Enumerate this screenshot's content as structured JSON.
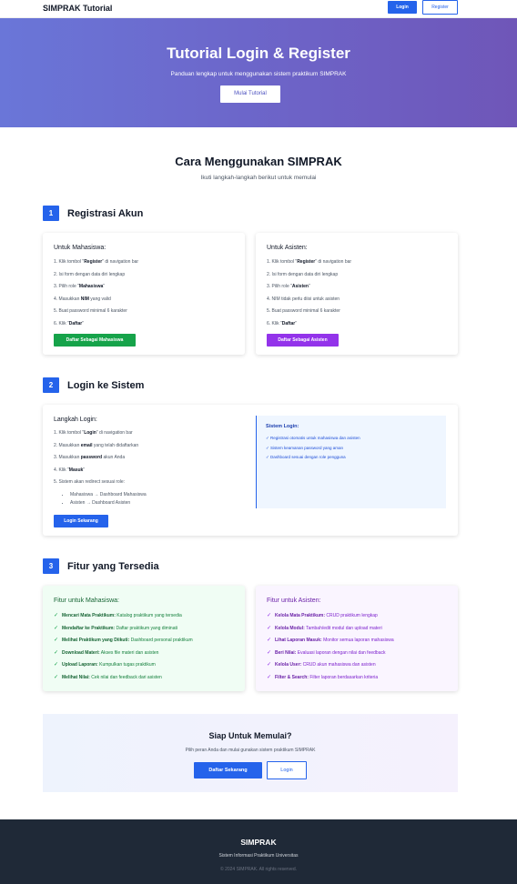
{
  "nav": {
    "brand": "SIMPRAK Tutorial",
    "login": "Login",
    "register": "Register"
  },
  "hero": {
    "title": "Tutorial Login & Register",
    "subtitle": "Panduan lengkap untuk menggunakan sistem praktikum SIMPRAK",
    "button": "Mulai Tutorial"
  },
  "intro": {
    "title": "Cara Menggunakan SIMPRAK",
    "subtitle": "Ikuti langkah-langkah berikut untuk memulai"
  },
  "step1": {
    "num": "1",
    "title": "Registrasi Akun",
    "mahasiswa": {
      "heading": "Untuk Mahasiswa:",
      "items": [
        {
          "pre": "1. Klik tombol \"",
          "b": "Register",
          "post": "\" di navigation bar"
        },
        {
          "pre": "2. Isi form dengan data diri lengkap",
          "b": "",
          "post": ""
        },
        {
          "pre": "3. Pilih role \"",
          "b": "Mahasiswa",
          "post": "\""
        },
        {
          "pre": "4. Masukkan ",
          "b": "NIM",
          "post": " yang valid"
        },
        {
          "pre": "5. Buat password minimal 6 karakter",
          "b": "",
          "post": ""
        },
        {
          "pre": "6. Klik \"",
          "b": "Daftar",
          "post": "\""
        }
      ],
      "button": "Daftar Sebagai Mahasiswa"
    },
    "asisten": {
      "heading": "Untuk Asisten:",
      "items": [
        {
          "pre": "1. Klik tombol \"",
          "b": "Register",
          "post": "\" di navigation bar"
        },
        {
          "pre": "2. Isi form dengan data diri lengkap",
          "b": "",
          "post": ""
        },
        {
          "pre": "3. Pilih role \"",
          "b": "Asisten",
          "post": "\""
        },
        {
          "pre": "4. NIM tidak perlu diisi untuk asisten",
          "b": "",
          "post": ""
        },
        {
          "pre": "5. Buat password minimal 6 karakter",
          "b": "",
          "post": ""
        },
        {
          "pre": "6. Klik \"",
          "b": "Daftar",
          "post": "\""
        }
      ],
      "button": "Daftar Sebagai Asisten"
    }
  },
  "step2": {
    "num": "2",
    "title": "Login ke Sistem",
    "heading": "Langkah Login:",
    "items": [
      {
        "pre": "1. Klik tombol \"",
        "b": "Login",
        "post": "\" di navigation bar"
      },
      {
        "pre": "2. Masukkan ",
        "b": "email",
        "post": " yang telah didaftarkan"
      },
      {
        "pre": "3. Masukkan ",
        "b": "password",
        "post": " akun Anda"
      },
      {
        "pre": "4. Klik \"",
        "b": "Masuk",
        "post": "\""
      },
      {
        "pre": "5. Sistem akan redirect sesuai role:",
        "b": "",
        "post": ""
      }
    ],
    "redirects": [
      "Mahasiswa → Dashboard Mahasiswa",
      "Asisten → Dashboard Asisten"
    ],
    "button": "Login Sekarang",
    "system": {
      "title": "Sistem Login:",
      "items": [
        "✓ Registrasi otomatis untuk mahasiswa dan asisten",
        "✓ Sistem keamanan password yang aman",
        "✓ Dashboard sesuai dengan role pengguna"
      ]
    }
  },
  "step3": {
    "num": "3",
    "title": "Fitur yang Tersedia",
    "mahasiswa": {
      "heading": "Fitur untuk Mahasiswa:",
      "items": [
        {
          "b": "Mencari Mata Praktikum:",
          "t": " Katalog praktikum yang tersedia"
        },
        {
          "b": "Mendaftar ke Praktikum:",
          "t": " Daftar praktikum yang diminati"
        },
        {
          "b": "Melihat Praktikum yang Diikuti:",
          "t": " Dashboard personal praktikum"
        },
        {
          "b": "Download Materi:",
          "t": " Akses file materi dan asisten"
        },
        {
          "b": "Upload Laporan:",
          "t": " Kumpulkan tugas praktikum"
        },
        {
          "b": "Melihat Nilai:",
          "t": " Cek nilai dan feedback dari asisten"
        }
      ]
    },
    "asisten": {
      "heading": "Fitur untuk Asisten:",
      "items": [
        {
          "b": "Kelola Mata Praktikum:",
          "t": " CRUD praktikum lengkap"
        },
        {
          "b": "Kelola Modul:",
          "t": " Tambah/edit modul dan upload materi"
        },
        {
          "b": "Lihat Laporan Masuk:",
          "t": " Monitor semua laporan mahasiswa"
        },
        {
          "b": "Beri Nilai:",
          "t": " Evaluasi laporan dengan nilai dan feedback"
        },
        {
          "b": "Kelola User:",
          "t": " CRUD akun mahasiswa dan asisten"
        },
        {
          "b": "Filter & Search:",
          "t": " Filter laporan berdasarkan kriteria"
        }
      ]
    }
  },
  "cta": {
    "title": "Siap Untuk Memulai?",
    "subtitle": "Pilih peran Anda dan mulai gunakan sistem praktikum SIMPRAK",
    "register": "Daftar Sekarang",
    "login": "Login"
  },
  "footer": {
    "brand": "SIMPRAK",
    "tagline": "Sistem Informasi Praktikum Universitas",
    "copyright": "© 2024 SIMPRAK. All rights reserved."
  },
  "colors": {
    "primary": "#2563eb",
    "green": "#16a34a",
    "purple": "#9333ea",
    "footer": "#1f2937"
  },
  "icons": {
    "check": "check-icon"
  }
}
